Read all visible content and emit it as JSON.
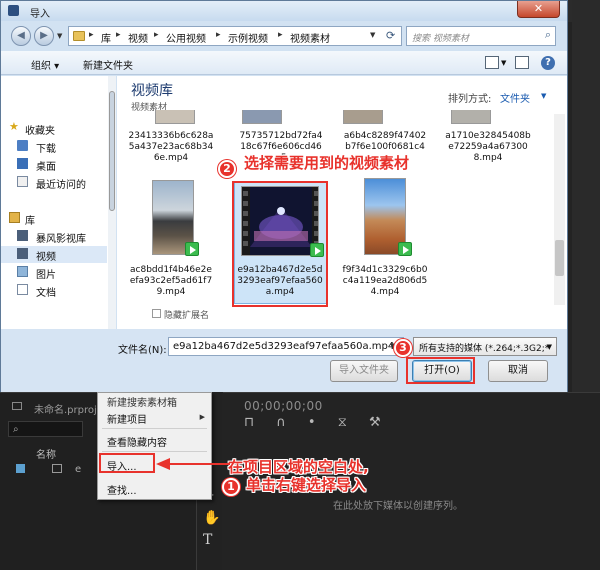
{
  "dialog": {
    "title": "导入",
    "close_glyph": "✕",
    "breadcrumb": [
      "库",
      "视频",
      "公用视频",
      "示例视频",
      "视频素材"
    ],
    "search_placeholder": "搜索 视频素材",
    "toolbar": {
      "organize": "组织 ▾",
      "new_folder": "新建文件夹"
    },
    "nav_tree": [
      {
        "label": "收藏夹",
        "icon": "star-icon",
        "group": true
      },
      {
        "label": "下载",
        "icon": "download-folder-icon"
      },
      {
        "label": "桌面",
        "icon": "desktop-icon"
      },
      {
        "label": "最近访问的",
        "icon": "recent-places-icon"
      },
      {
        "label": "库",
        "icon": "library-icon",
        "group": true
      },
      {
        "label": "暴风影视库",
        "icon": "video-library-icon"
      },
      {
        "label": "视频",
        "icon": "video-library-icon",
        "selected": true
      },
      {
        "label": "图片",
        "icon": "pictures-library-icon"
      },
      {
        "label": "文档",
        "icon": "documents-library-icon"
      }
    ],
    "library_title": "视频库",
    "library_subtitle": "视频素材",
    "arrange_label": "排列方式:",
    "arrange_value": "文件夹",
    "files_top": [
      "23413336b6c628a5a437e23ac68b346e.mp4",
      "75735712bd72fa418c67f6e606cd46e5",
      "a6b4c8289f47402b7f6e100f0681c4",
      "a1710e32845408be72259a4a673008.mp4"
    ],
    "files_bottom": [
      "ac8bdd1f4b46e2eefa93c2ef5ad61f79.mp4",
      "e9a12ba467d2e5d3293eaf97efaa560a.mp4",
      "f9f34d1c3329c6b0c4a119ea2d806d54.mp4"
    ],
    "hide_extensions": "隐藏扩展名",
    "filename_label": "文件名(N):",
    "filename_value": "e9a12ba467d2e5d3293eaf97efaa560a.mp4",
    "filetype_value": "所有支持的媒体 (*.264;*.3G2;*",
    "btn_import_folder": "导入文件夹",
    "btn_open": "打开(O)",
    "btn_cancel": "取消"
  },
  "context_menu": {
    "items": [
      "新建搜索素材箱",
      "新建项目",
      "查看隐藏内容",
      "导入...",
      "查找..."
    ]
  },
  "premiere": {
    "project_name": "未命名.prproj",
    "column_name": "名称",
    "clip_label": "e",
    "timecode": "00;00;00;00",
    "timeline_tools": "⊓ ∩ • ⧖ ⚒",
    "drop_hint": "在此处放下媒体以创建序列。"
  },
  "annotations": {
    "step1_num": "1",
    "step1_text_line1": "在项目区域的空白处,",
    "step1_text_line2": "单击右键选择导入",
    "step2_num": "2",
    "step2_text": "选择需要用到的视频素材",
    "step3_num": "3",
    "accent_red": "#e8322c"
  }
}
